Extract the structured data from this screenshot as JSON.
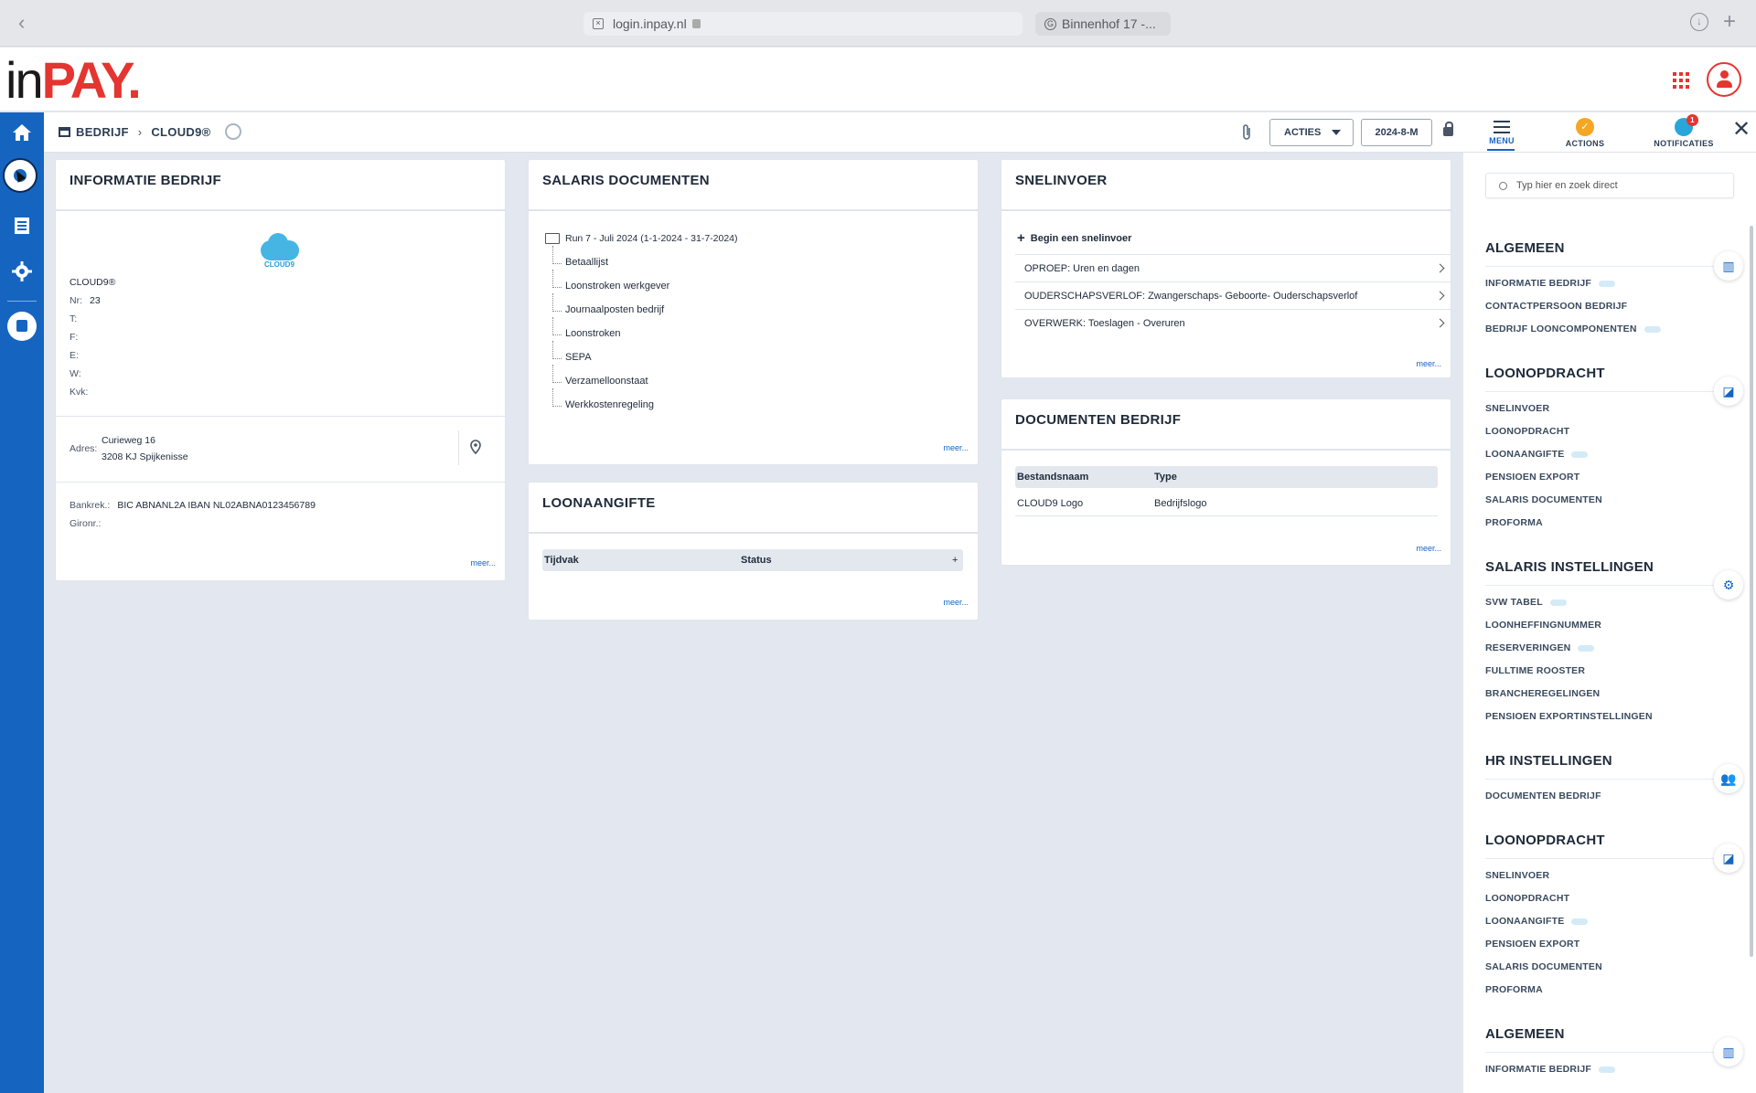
{
  "browser": {
    "url": "login.inpay.nl",
    "second_tab": "Binnenhof 17 -..."
  },
  "brand": {
    "logo_in": "in",
    "logo_pay": "PAY",
    "logo_dot": ".",
    "accent": "#e43530",
    "primary": "#1565c0"
  },
  "toolbar": {
    "breadcrumb": [
      "BEDRIJF",
      "CLOUD9®"
    ],
    "acties_label": "ACTIES",
    "period_label": "2024-8-M"
  },
  "right_panel": {
    "tabs": [
      {
        "label": "MENU"
      },
      {
        "label": "ACTIONS"
      },
      {
        "label": "NOTIFICATIES",
        "badge": "1"
      }
    ],
    "search_placeholder": "Typ hier en zoek direct",
    "sections": [
      {
        "title": "ALGEMEEN",
        "items": [
          {
            "label": "INFORMATIE BEDRIJF",
            "dots": true
          },
          {
            "label": "CONTACTPERSOON BEDRIJF"
          },
          {
            "label": "BEDRIJF LOONCOMPONENTEN",
            "dots": true
          }
        ]
      },
      {
        "title": "LOONOPDRACHT",
        "items": [
          {
            "label": "SNELINVOER"
          },
          {
            "label": "LOONOPDRACHT"
          },
          {
            "label": "LOONAANGIFTE",
            "dots": true
          },
          {
            "label": "PENSIOEN EXPORT"
          },
          {
            "label": "SALARIS DOCUMENTEN"
          },
          {
            "label": "PROFORMA"
          }
        ]
      },
      {
        "title": "SALARIS INSTELLINGEN",
        "items": [
          {
            "label": "SVW TABEL",
            "dots": true
          },
          {
            "label": "LOONHEFFINGNUMMER"
          },
          {
            "label": "RESERVERINGEN",
            "dots": true
          },
          {
            "label": "FULLTIME ROOSTER"
          },
          {
            "label": "BRANCHEREGELINGEN"
          },
          {
            "label": "PENSIOEN EXPORTINSTELLINGEN"
          }
        ]
      },
      {
        "title": "HR INSTELLINGEN",
        "items": [
          {
            "label": "DOCUMENTEN BEDRIJF"
          }
        ]
      },
      {
        "title": "LOONOPDRACHT",
        "items": [
          {
            "label": "SNELINVOER"
          },
          {
            "label": "LOONOPDRACHT"
          },
          {
            "label": "LOONAANGIFTE",
            "dots": true
          },
          {
            "label": "PENSIOEN EXPORT"
          },
          {
            "label": "SALARIS DOCUMENTEN"
          },
          {
            "label": "PROFORMA"
          }
        ]
      },
      {
        "title": "ALGEMEEN",
        "items": [
          {
            "label": "INFORMATIE BEDRIJF",
            "dots": true
          }
        ]
      }
    ]
  },
  "info": {
    "title": "INFORMATIE BEDRIJF",
    "logo_text": "CLOUD9",
    "name": "CLOUD9®",
    "nr_label": "Nr:",
    "nr": "23",
    "t_label": "T:",
    "f_label": "F:",
    "e_label": "E:",
    "w_label": "W:",
    "kvk_label": "Kvk:",
    "adres_label": "Adres:",
    "adres_line1": "Curieweg 16",
    "adres_line2": "3208 KJ Spijkenisse",
    "bank_label": "Bankrek.:",
    "bank_value": "BIC ABNANL2A IBAN NL02ABNA0123456789",
    "giro_label": "Gironr.:",
    "meer": "meer..."
  },
  "salaris": {
    "title": "SALARIS DOCUMENTEN",
    "root": "Run 7 - Juli 2024 (1-1-2024 - 31-7-2024)",
    "items": [
      "Betaallijst",
      "Loonstroken werkgever",
      "Journaalposten bedrijf",
      "Loonstroken",
      "SEPA",
      "Verzamelloonstaat",
      "Werkkostenregeling"
    ],
    "meer": "meer..."
  },
  "loonaangifte": {
    "title": "LOONAANGIFTE",
    "col1": "Tijdvak",
    "col2": "Status",
    "add": "+",
    "meer": "meer..."
  },
  "snelinvoer": {
    "title": "SNELINVOER",
    "begin": "Begin een snelinvoer",
    "rows": [
      "OPROEP: Uren en dagen",
      "OUDERSCHAPSVERLOF: Zwangerschaps- Geboorte- Ouderschapsverlof",
      "OVERWERK: Toeslagen - Overuren"
    ],
    "meer": "meer..."
  },
  "documenten": {
    "title": "DOCUMENTEN BEDRIJF",
    "col1": "Bestandsnaam",
    "col2": "Type",
    "row_name": "CLOUD9 Logo",
    "row_type": "Bedrijfslogo",
    "meer": "meer..."
  }
}
